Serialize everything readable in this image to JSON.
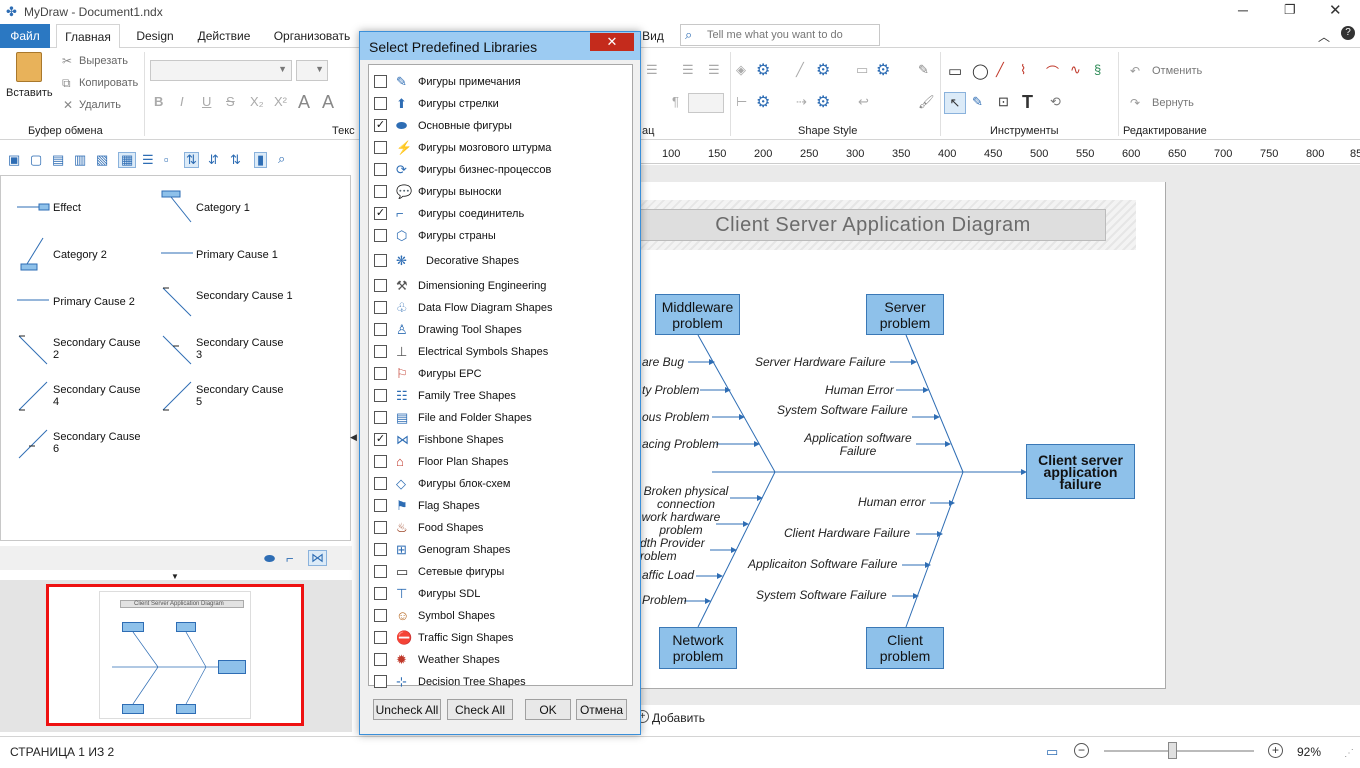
{
  "app": {
    "title": "MyDraw - Document1.ndx"
  },
  "ribbon": {
    "tabs": [
      "Файл",
      "Главная",
      "Design",
      "Действие",
      "Организовать",
      "Вид"
    ],
    "search_placeholder": "Tell me what you want to do",
    "clipboard": {
      "paste": "Вставить",
      "cut": "Вырезать",
      "copy": "Копировать",
      "delete": "Удалить",
      "group": "Буфер обмена"
    },
    "groups": {
      "text": "Текс",
      "paragraph": "ац",
      "shape_style": "Shape Style",
      "tools": "Инструменты",
      "editing": "Редактирование"
    },
    "undo": "Отменить",
    "redo": "Вернуть"
  },
  "shapes_panel": {
    "items": [
      "Effect",
      "Category 1",
      "Category 2",
      "Primary Cause 1",
      "Primary Cause 2",
      "Secondary Cause 1",
      "Secondary Cause 2",
      "Secondary Cause 3",
      "Secondary Cause 4",
      "Secondary Cause 5",
      "Secondary Cause 6"
    ]
  },
  "dialog": {
    "title": "Select Predefined Libraries",
    "libraries": [
      {
        "label": "Фигуры примечания",
        "checked": false
      },
      {
        "label": "Фигуры стрелки",
        "checked": false
      },
      {
        "label": "Основные фигуры",
        "checked": true
      },
      {
        "label": "Фигуры мозгового штурма",
        "checked": false
      },
      {
        "label": "Фигуры бизнес-процессов",
        "checked": false
      },
      {
        "label": "Фигуры выноски",
        "checked": false
      },
      {
        "label": "Фигуры соединитель",
        "checked": true
      },
      {
        "label": "Фигуры страны",
        "checked": false
      },
      {
        "label": "Decorative Shapes",
        "checked": false
      },
      {
        "label": "Dimensioning Engineering",
        "checked": false
      },
      {
        "label": "Data Flow Diagram Shapes",
        "checked": false
      },
      {
        "label": "Drawing Tool Shapes",
        "checked": false
      },
      {
        "label": "Electrical Symbols Shapes",
        "checked": false
      },
      {
        "label": "Фигуры EPC",
        "checked": false
      },
      {
        "label": "Family Tree Shapes",
        "checked": false
      },
      {
        "label": "File and Folder Shapes",
        "checked": false
      },
      {
        "label": "Fishbone Shapes",
        "checked": true
      },
      {
        "label": "Floor Plan Shapes",
        "checked": false
      },
      {
        "label": "Фигуры блок-схем",
        "checked": false
      },
      {
        "label": "Flag Shapes",
        "checked": false
      },
      {
        "label": "Food Shapes",
        "checked": false
      },
      {
        "label": "Genogram Shapes",
        "checked": false
      },
      {
        "label": "Сетевые фигуры",
        "checked": false
      },
      {
        "label": "Фигуры SDL",
        "checked": false
      },
      {
        "label": "Symbol Shapes",
        "checked": false
      },
      {
        "label": "Traffic Sign Shapes",
        "checked": false
      },
      {
        "label": "Weather Shapes",
        "checked": false
      },
      {
        "label": "Decision Tree Shapes",
        "checked": false
      }
    ],
    "buttons": {
      "uncheck_all": "Uncheck All",
      "check_all": "Check All",
      "ok": "OK",
      "cancel": "Отмена"
    }
  },
  "ruler": [
    "100",
    "150",
    "200",
    "250",
    "300",
    "350",
    "400",
    "450",
    "500",
    "550",
    "600",
    "650",
    "700",
    "750",
    "800",
    "85"
  ],
  "diagram": {
    "title": "Client Server Application Diagram",
    "boxes": {
      "middleware": "Middleware problem",
      "server": "Server problem",
      "network": "Network problem",
      "client": "Client problem",
      "effect": "Client server application failure"
    },
    "causes": {
      "mw1": "are Bug",
      "mw2": "ty Problem",
      "mw3": "ous Problem",
      "mw4": "acing Problem",
      "sv1": "Server Hardware Failure",
      "sv2": "Human Error",
      "sv3": "System Software Failure",
      "sv4": "Application software Failure",
      "nw1": "Broken physical connection",
      "nw2": "work hardware problem",
      "nw3": "dth Provider roblem",
      "nw4": "affic Load",
      "nw5": "Problem",
      "cl1": "Human error",
      "cl2": "Client Hardware Failure",
      "cl3": "Applicaiton Software Failure",
      "cl4": "System Software Failure"
    }
  },
  "thumbnail": {
    "title": "Client Server Application Diagram"
  },
  "add_page": "Добавить",
  "status": {
    "page": "СТРАНИЦА 1 ИЗ 2",
    "zoom": "92%"
  }
}
